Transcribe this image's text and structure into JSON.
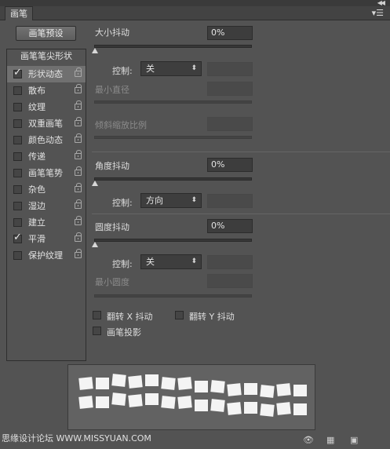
{
  "panel": {
    "tab_label": "画笔"
  },
  "left": {
    "preset_button": "画笔预设",
    "header": "画笔笔尖形状",
    "items": [
      {
        "label": "形状动态",
        "checked": true,
        "active": true
      },
      {
        "label": "散布",
        "checked": false,
        "active": false
      },
      {
        "label": "纹理",
        "checked": false,
        "active": false
      },
      {
        "label": "双重画笔",
        "checked": false,
        "active": false
      },
      {
        "label": "颜色动态",
        "checked": false,
        "active": false
      },
      {
        "label": "传递",
        "checked": false,
        "active": false
      },
      {
        "label": "画笔笔势",
        "checked": false,
        "active": false
      },
      {
        "label": "杂色",
        "checked": false,
        "active": false
      },
      {
        "label": "湿边",
        "checked": false,
        "active": false
      },
      {
        "label": "建立",
        "checked": false,
        "active": false
      },
      {
        "label": "平滑",
        "checked": true,
        "active": false
      },
      {
        "label": "保护纹理",
        "checked": false,
        "active": false
      }
    ]
  },
  "size_jitter": {
    "label": "大小抖动",
    "value": "0%",
    "level": 0,
    "control_label": "控制:",
    "control_value": "关",
    "min_diameter_label": "最小直径",
    "tilt_scale_label": "倾斜缩放比例"
  },
  "angle_jitter": {
    "label": "角度抖动",
    "value": "0%",
    "level": 0,
    "control_label": "控制:",
    "control_value": "方向"
  },
  "roundness_jitter": {
    "label": "圆度抖动",
    "value": "0%",
    "level": 0,
    "control_label": "控制:",
    "control_value": "关",
    "min_roundness_label": "最小圆度"
  },
  "options": {
    "flip_x": "翻转 X 抖动",
    "flip_y": "翻转 Y 抖动",
    "projection": "画笔投影"
  },
  "watermark": "思缘设计论坛 WWW.MISSYUAN.COM",
  "icons": {
    "collapse": "double-chevron-right-icon",
    "menu": "panel-menu-icon",
    "lock": "lock-icon",
    "eye": "visibility-toggle-icon",
    "grid": "grid-icon",
    "new": "new-preset-icon"
  }
}
